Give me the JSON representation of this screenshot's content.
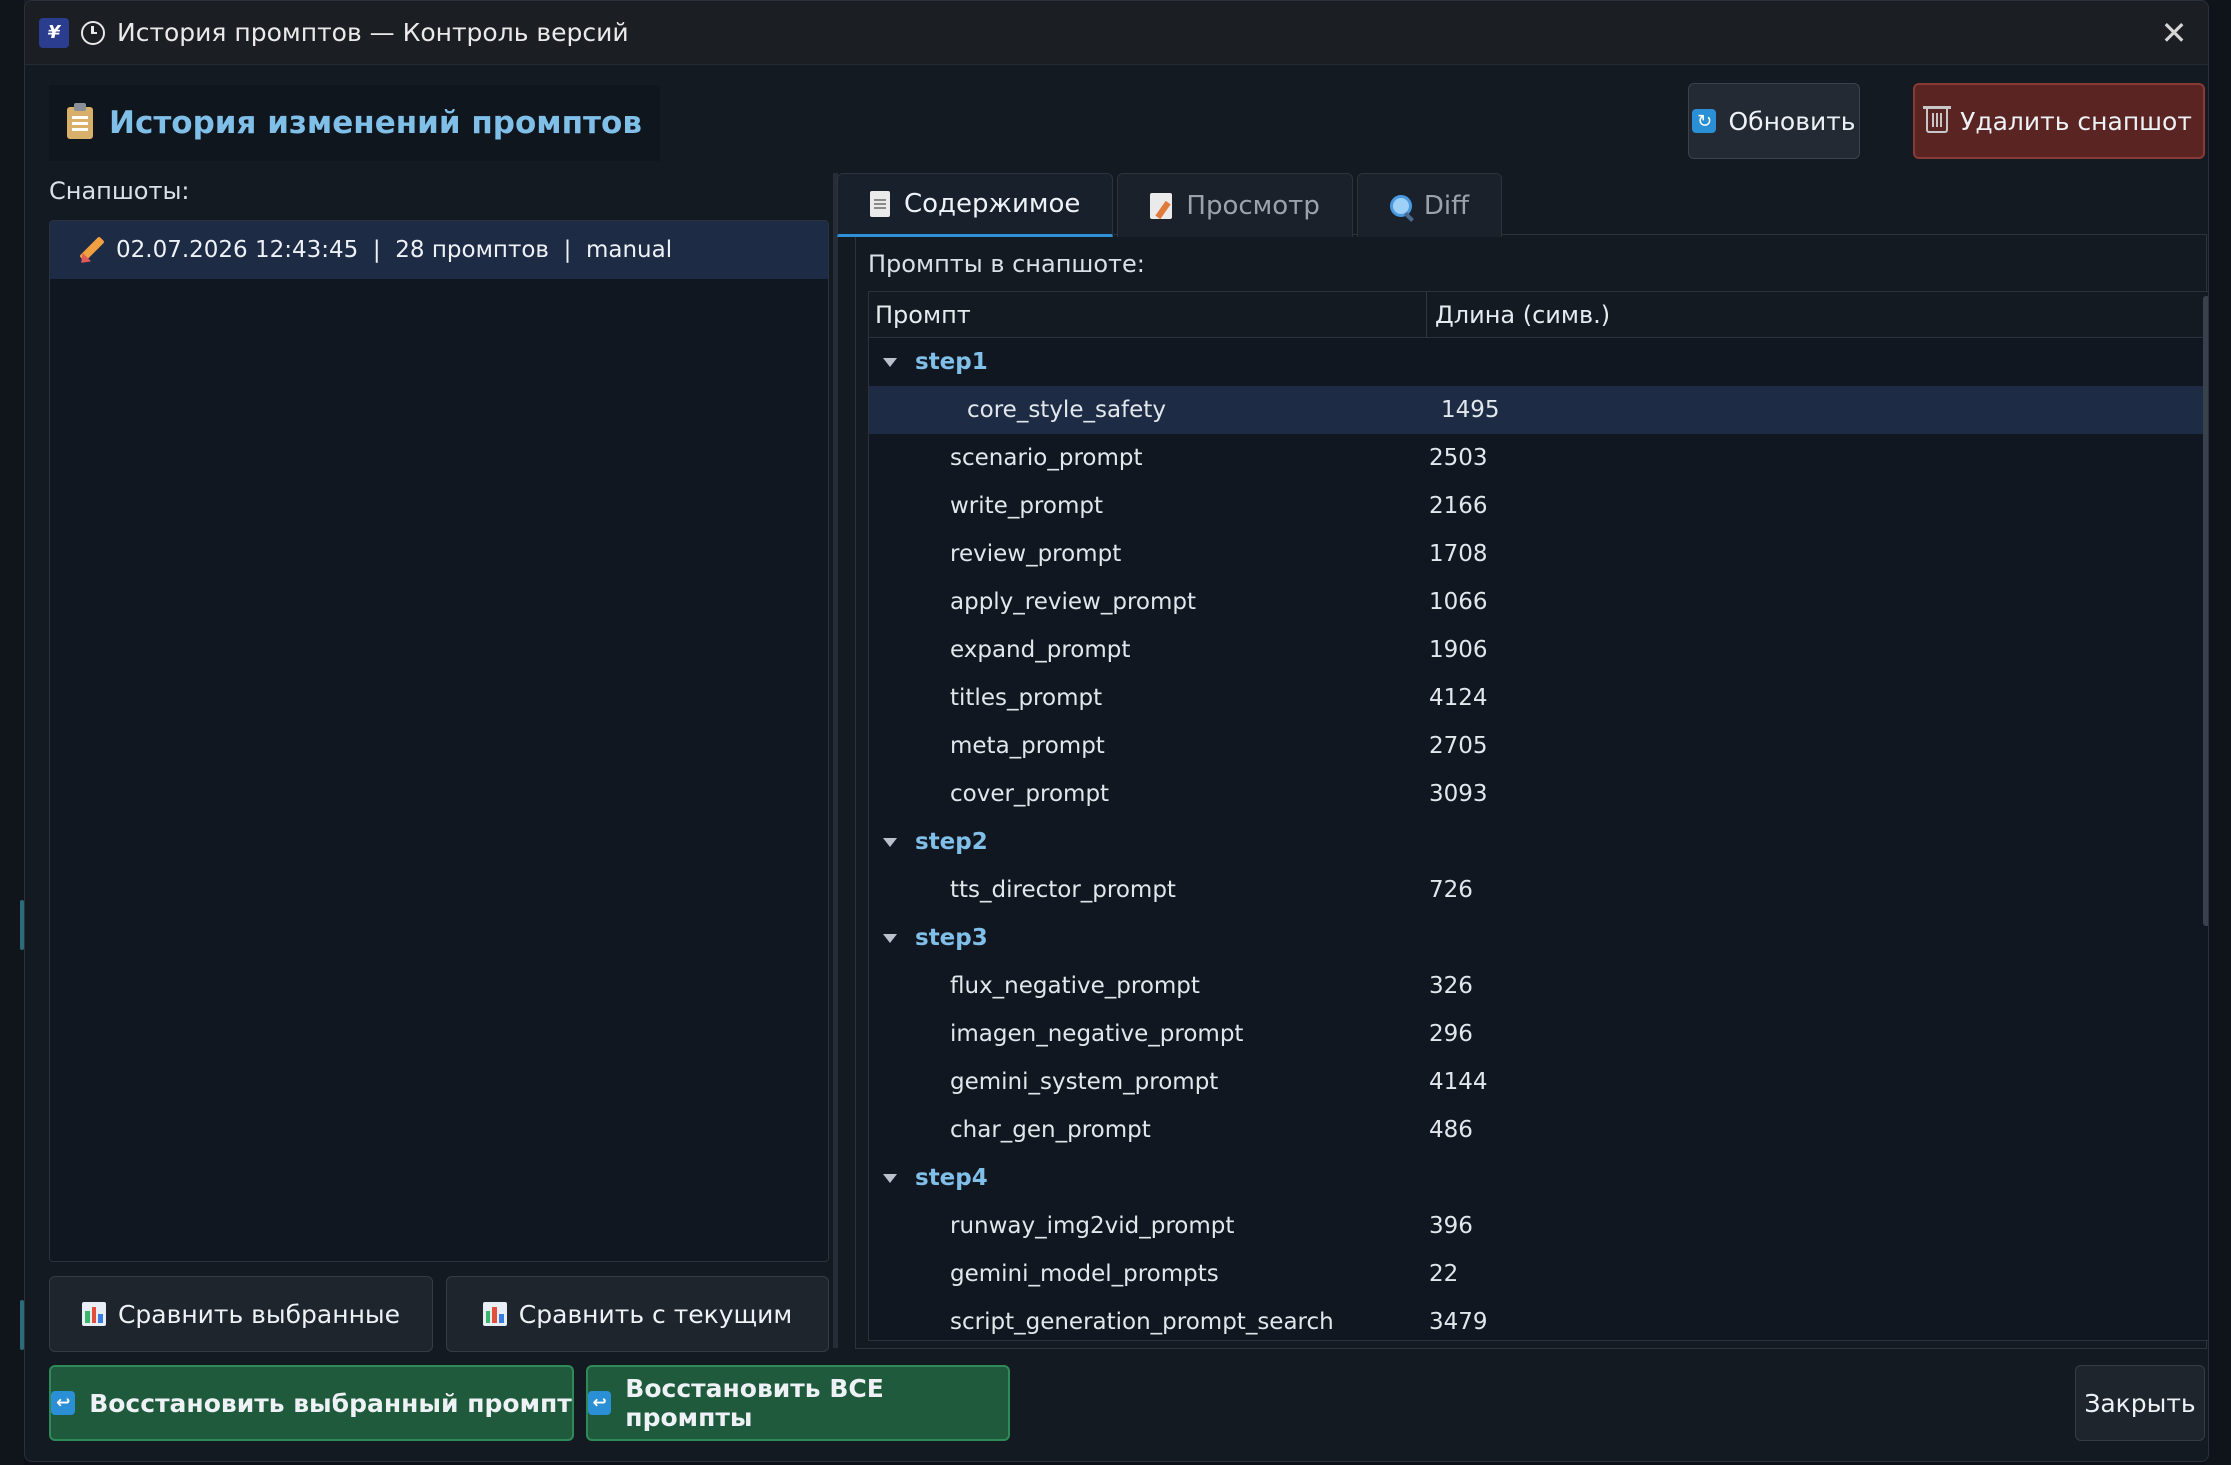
{
  "window": {
    "title": "История промптов — Контроль версий"
  },
  "header": {
    "title": "История изменений промптов",
    "refresh_label": "Обновить",
    "delete_label": "Удалить снапшот"
  },
  "snapshots": {
    "label": "Снапшоты:",
    "items": [
      {
        "text": "02.07.2026 12:43:45  |  28 промптов  |  manual"
      }
    ],
    "compare_selected_label": "Сравнить выбранные",
    "compare_current_label": "Сравнить с текущим"
  },
  "tabs": [
    {
      "label": "Содержимое",
      "icon": "document-icon",
      "active": true
    },
    {
      "label": "Просмотр",
      "icon": "memo-icon",
      "active": false
    },
    {
      "label": "Diff",
      "icon": "magnifier-icon",
      "active": false
    }
  ],
  "content": {
    "label": "Промпты в снапшоте:",
    "columns": [
      "Промпт",
      "Длина (симв.)"
    ],
    "groups": [
      {
        "name": "step1",
        "items": [
          {
            "name": "core_style_safety",
            "length": "1495",
            "selected": true
          },
          {
            "name": "scenario_prompt",
            "length": "2503"
          },
          {
            "name": "write_prompt",
            "length": "2166"
          },
          {
            "name": "review_prompt",
            "length": "1708"
          },
          {
            "name": "apply_review_prompt",
            "length": "1066"
          },
          {
            "name": "expand_prompt",
            "length": "1906"
          },
          {
            "name": "titles_prompt",
            "length": "4124"
          },
          {
            "name": "meta_prompt",
            "length": "2705"
          },
          {
            "name": "cover_prompt",
            "length": "3093"
          }
        ]
      },
      {
        "name": "step2",
        "items": [
          {
            "name": "tts_director_prompt",
            "length": "726"
          }
        ]
      },
      {
        "name": "step3",
        "items": [
          {
            "name": "flux_negative_prompt",
            "length": "326"
          },
          {
            "name": "imagen_negative_prompt",
            "length": "296"
          },
          {
            "name": "gemini_system_prompt",
            "length": "4144"
          },
          {
            "name": "char_gen_prompt",
            "length": "486"
          }
        ]
      },
      {
        "name": "step4",
        "items": [
          {
            "name": "runway_img2vid_prompt",
            "length": "396"
          },
          {
            "name": "gemini_model_prompts",
            "length": "22"
          },
          {
            "name": "script_generation_prompt_search",
            "length": "3479"
          }
        ]
      }
    ]
  },
  "footer": {
    "restore_selected_label": "Восстановить выбранный промпт",
    "restore_all_label": "Восстановить ВСЕ промпты",
    "close_label": "Закрыть"
  },
  "colors": {
    "accent": "#2f8fd8",
    "group_text": "#7fbfe8",
    "selection": "#1d2b45",
    "danger": "#5a2422",
    "success": "#1f5a3c"
  }
}
